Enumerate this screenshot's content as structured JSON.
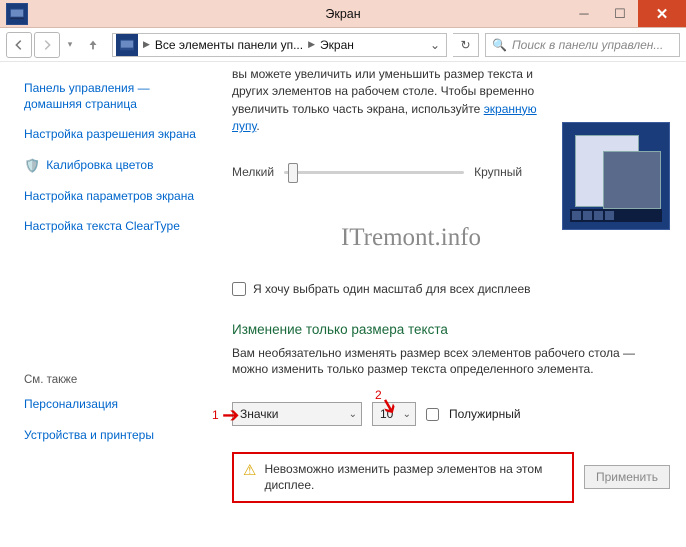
{
  "window": {
    "title": "Экран"
  },
  "nav": {
    "crumb1": "Все элементы панели уп...",
    "crumb2": "Экран",
    "search_placeholder": "Поиск в панели управлен..."
  },
  "sidebar": {
    "home": "Панель управления — домашняя страница",
    "links": [
      "Настройка разрешения экрана",
      "Калибровка цветов",
      "Настройка параметров экрана",
      "Настройка текста ClearType"
    ],
    "see_also_heading": "См. также",
    "see_also": [
      "Персонализация",
      "Устройства и принтеры"
    ]
  },
  "main": {
    "intro_prefix": "вы можете увеличить или уменьшить размер текста и других элементов на рабочем столе. Чтобы временно увеличить только часть экрана, используйте ",
    "intro_link": "экранную лупу",
    "intro_suffix": ".",
    "slider_small": "Мелкий",
    "slider_large": "Крупный",
    "watermark": "ITremont.info",
    "checkbox_label": "Я хочу выбрать один масштаб для всех дисплеев",
    "section_heading": "Изменение только размера текста",
    "section_text": "Вам необязательно изменять размер всех элементов рабочего стола — можно изменить только размер текста определенного элемента.",
    "annot1": "1",
    "annot2": "2",
    "element_combo": "Значки",
    "size_combo": "10",
    "bold_label": "Полужирный",
    "warning_text": "Невозможно изменить размер элементов на этом дисплее.",
    "apply_label": "Применить"
  }
}
